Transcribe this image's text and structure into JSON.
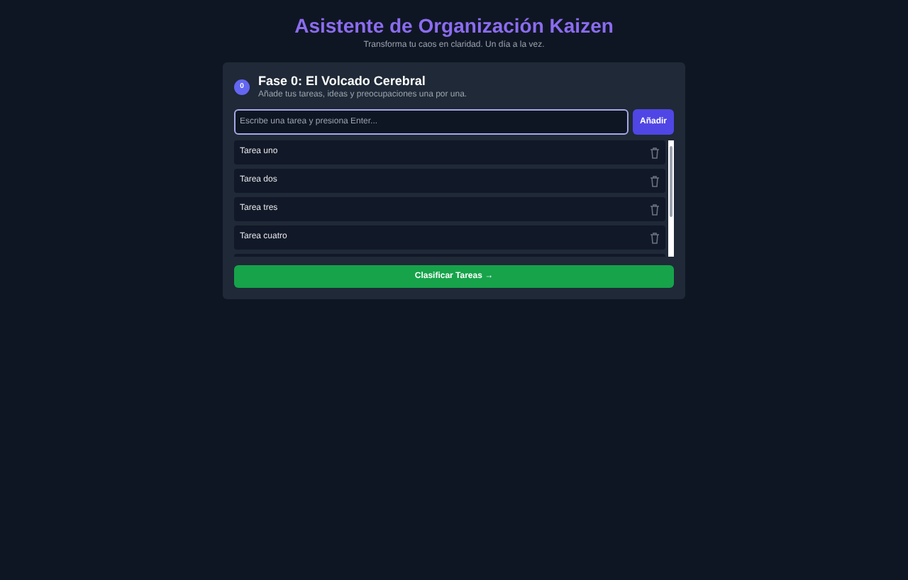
{
  "header": {
    "title": "Asistente de Organización Kaizen",
    "subtitle": "Transforma tu caos en claridad. Un día a la vez."
  },
  "phase": {
    "number": "0",
    "title": "Fase 0: El Volcado Cerebral",
    "description": "Añade tus tareas, ideas y preocupaciones una por una."
  },
  "input": {
    "placeholder": "Escribe una tarea y presiona Enter...",
    "add_button": "Añadir"
  },
  "tasks": [
    {
      "label": "Tarea uno"
    },
    {
      "label": "Tarea dos"
    },
    {
      "label": "Tarea tres"
    },
    {
      "label": "Tarea cuatro"
    }
  ],
  "classify_button": "Clasificar Tareas →"
}
